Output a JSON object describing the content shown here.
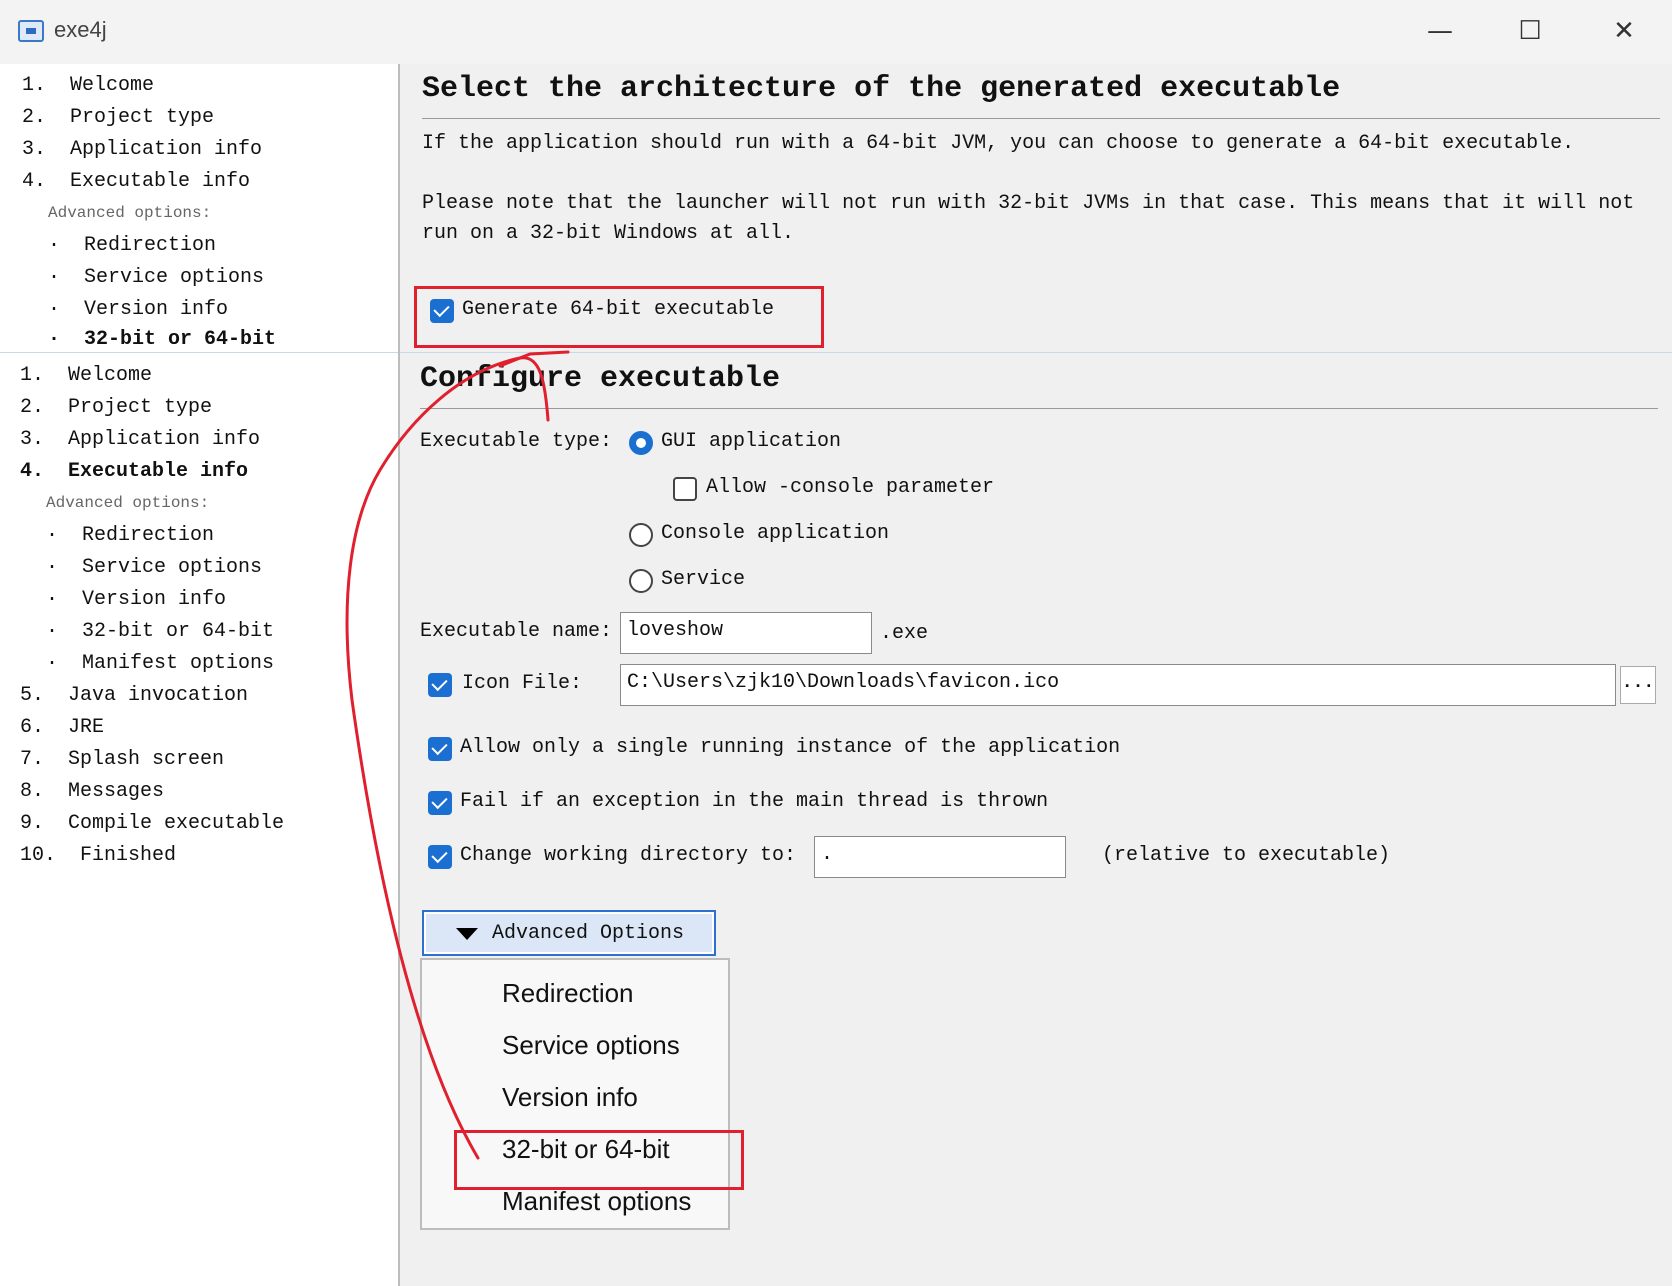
{
  "window": {
    "title": "exe4j"
  },
  "top_screen": {
    "nav": [
      {
        "label": "1.  Welcome"
      },
      {
        "label": "2.  Project type"
      },
      {
        "label": "3.  Application info"
      },
      {
        "label": "4.  Executable info"
      },
      {
        "label": "Advanced options:"
      },
      {
        "label": "·  Redirection"
      },
      {
        "label": "·  Service options"
      },
      {
        "label": "·  Version info"
      },
      {
        "label": "·  32-bit or 64-bit"
      }
    ],
    "heading": "Select the architecture of the generated executable",
    "para1": "If the application should run with a 64-bit JVM, you can choose to generate a 64-bit executable.",
    "para2_line1": "Please note that the launcher will not run with 32-bit JVMs in that case. This means that it will not",
    "para2_line2": "run on a 32-bit Windows at all.",
    "checkbox_64bit": {
      "label": "Generate 64-bit executable",
      "checked": true
    }
  },
  "bottom_screen": {
    "nav": [
      {
        "label": "1.  Welcome"
      },
      {
        "label": "2.  Project type"
      },
      {
        "label": "3.  Application info"
      },
      {
        "label": "4.  Executable info"
      },
      {
        "label": "Advanced options:"
      },
      {
        "label": "·  Redirection"
      },
      {
        "label": "·  Service options"
      },
      {
        "label": "·  Version info"
      },
      {
        "label": "·  32-bit or 64-bit"
      },
      {
        "label": "·  Manifest options"
      },
      {
        "label": "5.  Java invocation"
      },
      {
        "label": "6.  JRE"
      },
      {
        "label": "7.  Splash screen"
      },
      {
        "label": "8.  Messages"
      },
      {
        "label": "9.  Compile executable"
      },
      {
        "label": "10.  Finished"
      }
    ],
    "heading": "Configure executable",
    "executable_type_label": "Executable type:",
    "radio_gui": {
      "label": "GUI application",
      "selected": true
    },
    "checkbox_console_param": {
      "label": "Allow -console parameter",
      "checked": false
    },
    "radio_console": {
      "label": "Console application",
      "selected": false
    },
    "radio_service": {
      "label": "Service",
      "selected": false
    },
    "executable_name_label": "Executable name:",
    "executable_name_value": "loveshow",
    "exe_suffix": ".exe",
    "icon_file": {
      "label": "Icon File:",
      "checked": true,
      "value": "C:\\Users\\zjk10\\Downloads\\favicon.ico",
      "browse_label": "..."
    },
    "single_instance": {
      "label": "Allow only a single running instance of the application",
      "checked": true
    },
    "fail_exception": {
      "label": "Fail if an exception in the main thread is thrown",
      "checked": true
    },
    "change_dir": {
      "label": "Change working directory to:",
      "checked": true,
      "value": ".",
      "note": "(relative to executable)"
    },
    "advanced_button": "Advanced Options",
    "advanced_menu": [
      "Redirection",
      "Service options",
      "Version info",
      "32-bit or 64-bit",
      "Manifest options"
    ]
  },
  "colors": {
    "accent": "#1a6fd1",
    "annotation": "#e0202e"
  }
}
